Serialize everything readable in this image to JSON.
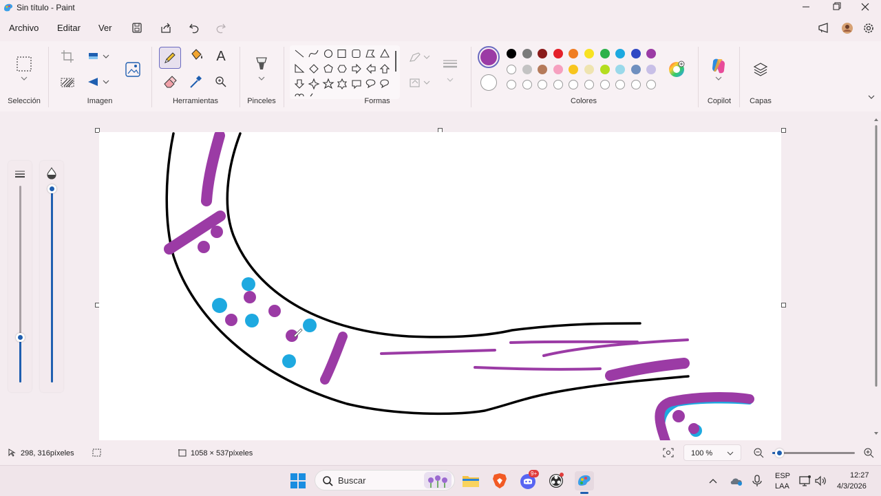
{
  "window": {
    "title": "Sin título - Paint"
  },
  "menu": {
    "file": "Archivo",
    "edit": "Editar",
    "view": "Ver"
  },
  "ribbon": {
    "groups": {
      "selection": "Selección",
      "image": "Imagen",
      "tools": "Herramientas",
      "brushes": "Pinceles",
      "shapes": "Formas",
      "colors": "Colores",
      "copilot": "Copilot",
      "layers": "Capas"
    },
    "text_tool_glyph": "A",
    "active_tool": "pencil",
    "primary_color": "#9b3ba5",
    "secondary_color": "#ffffff",
    "palette_row1": [
      "#000000",
      "#7a7a7a",
      "#8a1a1a",
      "#e4202a",
      "#f07d22",
      "#f8e222",
      "#2cb14a",
      "#1ea9e0",
      "#3048c4",
      "#9b3ba5"
    ],
    "palette_row2": [
      "#ffffff",
      "#c3c3c3",
      "#b57a5a",
      "#f6a0bf",
      "#f8c51e",
      "#efe4b0",
      "#b4dd1f",
      "#9ad9ea",
      "#6f8fbf",
      "#c8bfe7"
    ],
    "palette_row3_empty": 10
  },
  "status": {
    "cursor_pos": "298, 316píxeles",
    "canvas_size": "1058 × 537píxeles",
    "zoom": "100 %",
    "zoom_level": 0.08
  },
  "taskbar": {
    "search_placeholder": "Buscar",
    "lang_top": "ESP",
    "lang_bottom": "LAA",
    "time": "12:27",
    "date": "4/3/2026",
    "discord_badge": "9+"
  },
  "sliders": {
    "size_level": 0.23,
    "opacity_level": 1.0
  },
  "canvas_art": {
    "stroke_colors": [
      "#000000",
      "#9b3ba5",
      "#1ea9e0"
    ]
  }
}
